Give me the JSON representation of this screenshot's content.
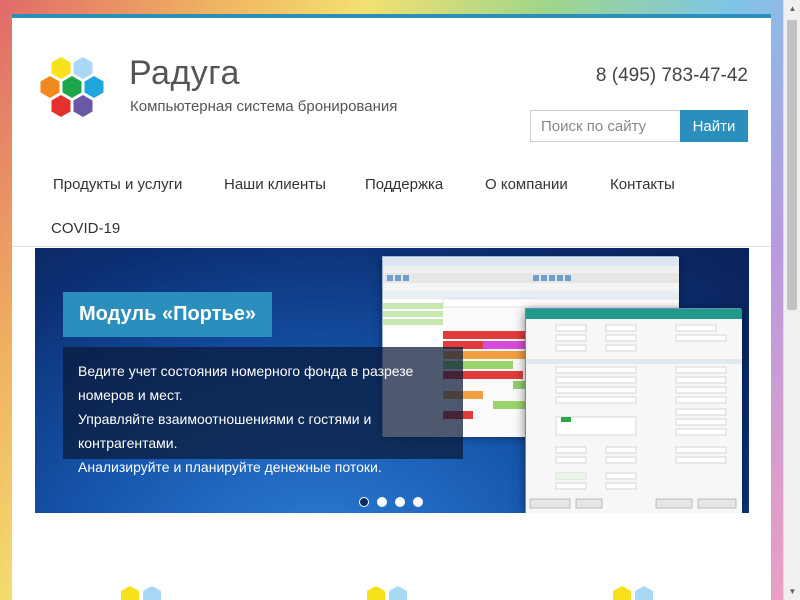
{
  "brand": {
    "title": "Радуга",
    "subtitle": "Компьютерная система бронирования",
    "logo_colors": [
      "#f7e11a",
      "#a9d8f4",
      "#f08a1f",
      "#1fa64a",
      "#1fa6df",
      "#e4312d",
      "#6a57a8"
    ]
  },
  "header": {
    "phone": "8 (495) 783-47-42",
    "search": {
      "placeholder": "Поиск по сайту",
      "button_label": "Найти"
    }
  },
  "nav": {
    "items": [
      {
        "label": "Продукты и услуги"
      },
      {
        "label": "Наши клиенты"
      },
      {
        "label": "Поддержка"
      },
      {
        "label": "О компании"
      },
      {
        "label": "Контакты"
      },
      {
        "label": "COVID-19"
      }
    ]
  },
  "banner": {
    "tag": "Модуль «Портье»",
    "lines": [
      "Ведите учет состояния номерного фонда в разрезе",
      "номеров и мест.",
      "Управляйте взаимоотношениями с гостями и",
      "контрагентами.",
      "Анализируйте и планируйте денежные потоки."
    ],
    "slides": {
      "count": 4,
      "active": 1
    }
  },
  "colors": {
    "accent": "#2b8fbd",
    "banner_dark": "#0a2258",
    "text": "#333333"
  }
}
